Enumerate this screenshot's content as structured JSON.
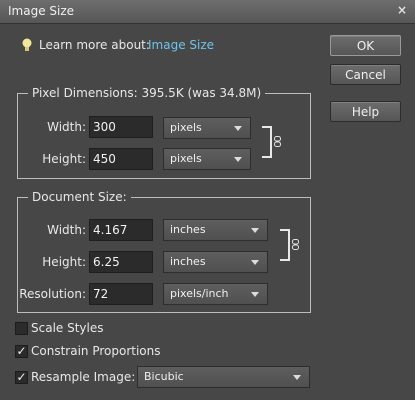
{
  "window": {
    "title": "Image Size",
    "close_glyph": "×"
  },
  "learn_more": {
    "label": "Learn more about:",
    "link": "Image Size",
    "icon": "lightbulb-icon"
  },
  "buttons": {
    "ok": "OK",
    "cancel": "Cancel",
    "help": "Help"
  },
  "pixel_dimensions": {
    "legend": "Pixel Dimensions:  395.5K (was 34.8M)",
    "width_label": "Width:",
    "width_value": "300",
    "width_unit": "pixels",
    "height_label": "Height:",
    "height_value": "450",
    "height_unit": "pixels"
  },
  "document_size": {
    "legend": "Document Size:",
    "width_label": "Width:",
    "width_value": "4.167",
    "width_unit": "inches",
    "height_label": "Height:",
    "height_value": "6.25",
    "height_unit": "inches",
    "resolution_label": "Resolution:",
    "resolution_value": "72",
    "resolution_unit": "pixels/inch"
  },
  "options": {
    "scale_styles": {
      "label": "Scale Styles",
      "checked": false
    },
    "constrain_proportions": {
      "label": "Constrain Proportions",
      "checked": true
    },
    "resample_image": {
      "label": "Resample Image:",
      "checked": true,
      "method": "Bicubic"
    }
  },
  "colors": {
    "background": "#474747",
    "link": "#6fc4ee",
    "text": "#e8e8e8"
  }
}
